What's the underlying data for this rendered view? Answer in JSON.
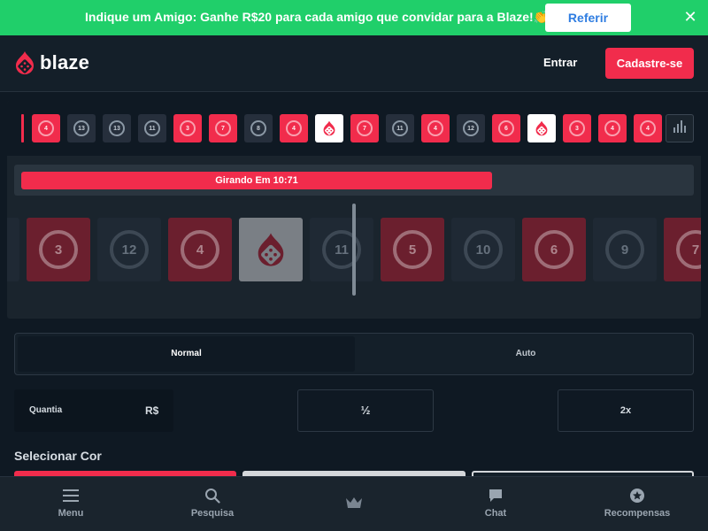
{
  "promo": {
    "text": "Indique um Amigo: Ganhe R$20 para cada amigo que convidar para a Blaze!👏",
    "button": "Referir",
    "close": "✕"
  },
  "header": {
    "logo": "blaze",
    "login": "Entrar",
    "signup": "Cadastre-se"
  },
  "history": [
    {
      "color": "red",
      "value": "4"
    },
    {
      "color": "black",
      "value": "13"
    },
    {
      "color": "black",
      "value": "13"
    },
    {
      "color": "black",
      "value": "11"
    },
    {
      "color": "red",
      "value": "3"
    },
    {
      "color": "red",
      "value": "7"
    },
    {
      "color": "black",
      "value": "8"
    },
    {
      "color": "red",
      "value": "4"
    },
    {
      "color": "white",
      "value": ""
    },
    {
      "color": "red",
      "value": "7"
    },
    {
      "color": "black",
      "value": "11"
    },
    {
      "color": "red",
      "value": "4"
    },
    {
      "color": "black",
      "value": "12"
    },
    {
      "color": "red",
      "value": "6"
    },
    {
      "color": "white",
      "value": ""
    },
    {
      "color": "red",
      "value": "3"
    },
    {
      "color": "red",
      "value": "4"
    },
    {
      "color": "red",
      "value": "4"
    }
  ],
  "timer": {
    "text": "Girando Em 10:71",
    "progress": 0.7
  },
  "roulette": [
    {
      "color": "black",
      "value": ""
    },
    {
      "color": "red",
      "value": "3"
    },
    {
      "color": "black",
      "value": "12"
    },
    {
      "color": "red",
      "value": "4"
    },
    {
      "color": "white",
      "value": ""
    },
    {
      "color": "black",
      "value": "11"
    },
    {
      "color": "red",
      "value": "5"
    },
    {
      "color": "black",
      "value": "10"
    },
    {
      "color": "red",
      "value": "6"
    },
    {
      "color": "black",
      "value": "9"
    },
    {
      "color": "red",
      "value": "7"
    }
  ],
  "modes": {
    "normal": "Normal",
    "auto": "Auto"
  },
  "bet": {
    "amount_label": "Quantia",
    "currency": "R$",
    "half": "½",
    "double": "2x"
  },
  "select_color_label": "Selecionar Cor",
  "colors": {
    "red": "#f12c4c",
    "white": "#ffffff",
    "black": "#262f3c",
    "promo_green": "#20cf6a"
  },
  "nav": {
    "menu": "Menu",
    "search": "Pesquisa",
    "chat": "Chat",
    "rewards": "Recompensas"
  }
}
